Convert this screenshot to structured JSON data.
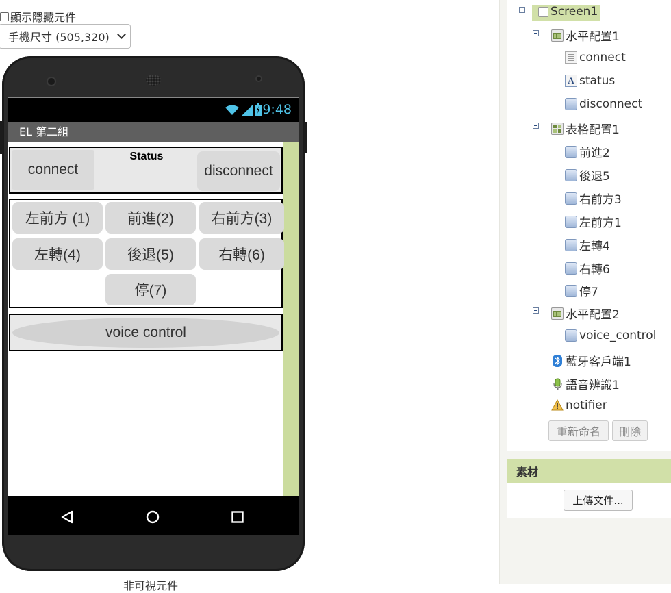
{
  "top": {
    "show_hidden_label": "顯示隱藏元件",
    "device_size": "手機尺寸 (505,320)"
  },
  "phone": {
    "time": "9:48",
    "app_title": "EL 第二組",
    "arr1": {
      "connect": "connect",
      "status": "Status",
      "disconnect": "disconnect"
    },
    "arr2": {
      "btn1": "左前方 (1)",
      "btn2": "前進(2)",
      "btn3": "右前方(3)",
      "btn4": "左轉(4)",
      "btn5": "後退(5)",
      "btn6": "右轉(6)",
      "btn7": "停(7)"
    },
    "arr3": {
      "voice": "voice control"
    },
    "below_label": "非可視元件"
  },
  "tree": {
    "screen1": "Screen1",
    "harr1": "水平配置1",
    "connect": "connect",
    "status": "status",
    "disconnect": "disconnect",
    "tarr1": "表格配置1",
    "fwd2": "前進2",
    "back5": "後退5",
    "rf3": "右前方3",
    "lf1": "左前方1",
    "lt4": "左轉4",
    "rt6": "右轉6",
    "stop7": "停7",
    "harr2": "水平配置2",
    "voice_control": "voice_control",
    "bt_client": "藍牙客戶端1",
    "speech": "語音辨識1",
    "notifier": "notifier",
    "rename_btn": "重新命名",
    "delete_btn": "刪除"
  },
  "assets": {
    "title": "素材",
    "upload_btn": "上傳文件..."
  }
}
